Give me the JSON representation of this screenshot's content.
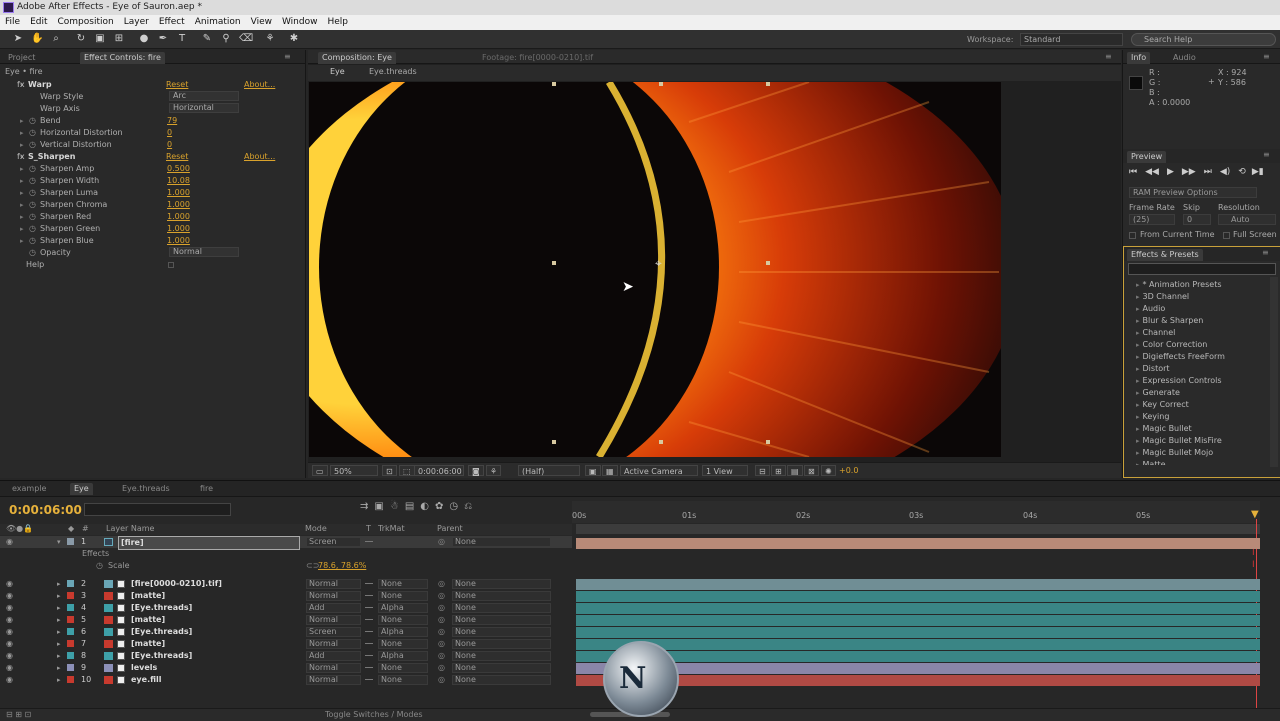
{
  "window": {
    "title": "Adobe After Effects - Eye of Sauron.aep *"
  },
  "menu": [
    "File",
    "Edit",
    "Composition",
    "Layer",
    "Effect",
    "Animation",
    "View",
    "Window",
    "Help"
  ],
  "toolbar": {
    "workspace_label": "Workspace:",
    "workspace_value": "Standard",
    "search_help": "Search Help"
  },
  "effect_panel": {
    "tabs": [
      "Project",
      "Effect Controls: fire"
    ],
    "breadcrumb": "Eye • fire",
    "warp": {
      "name": "Warp",
      "reset": "Reset",
      "about": "About...",
      "props": [
        {
          "label": "Warp Style",
          "value": "Arc",
          "type": "dropdown"
        },
        {
          "label": "Warp Axis",
          "value": "Horizontal",
          "type": "dropdown"
        },
        {
          "label": "Bend",
          "value": "79"
        },
        {
          "label": "Horizontal Distortion",
          "value": "0"
        },
        {
          "label": "Vertical Distortion",
          "value": "0"
        }
      ]
    },
    "sharpen": {
      "name": "S_Sharpen",
      "reset": "Reset",
      "about": "About...",
      "props": [
        {
          "label": "Sharpen Amp",
          "value": "0.500"
        },
        {
          "label": "Sharpen Width",
          "value": "10.08"
        },
        {
          "label": "Sharpen Luma",
          "value": "1.000"
        },
        {
          "label": "Sharpen Chroma",
          "value": "1.000"
        },
        {
          "label": "Sharpen Red",
          "value": "1.000"
        },
        {
          "label": "Sharpen Green",
          "value": "1.000"
        },
        {
          "label": "Sharpen Blue",
          "value": "1.000"
        },
        {
          "label": "Opacity",
          "value": "Normal",
          "type": "dropdown"
        },
        {
          "label": "Help",
          "value": ""
        }
      ]
    }
  },
  "comp_panel": {
    "tab": "Composition: Eye",
    "footage_tab": "Footage: fire[0000-0210].tif",
    "breadcrumbs": [
      "Eye",
      "Eye.threads"
    ],
    "bottom": {
      "zoom": "50%",
      "timecode": "0:00:06:00",
      "resolution": "(Half)",
      "camera": "Active Camera",
      "views": "1 View",
      "exposure": "+0.0"
    }
  },
  "info_panel": {
    "tabs": [
      "Info",
      "Audio"
    ],
    "r": "R :",
    "g": "G :",
    "b": "B :",
    "a": "A : 0.0000",
    "x": "X : 924",
    "y": "Y : 586"
  },
  "preview_panel": {
    "tab": "Preview",
    "ram_options": "RAM Preview Options",
    "frame_rate_label": "Frame Rate",
    "skip_label": "Skip",
    "resolution_label": "Resolution",
    "frame_rate": "(25)",
    "skip": "0",
    "resolution": "Auto",
    "from_current": "From Current Time",
    "full_screen": "Full Screen"
  },
  "effects_presets": {
    "tab": "Effects & Presets",
    "items": [
      "* Animation Presets",
      "3D Channel",
      "Audio",
      "Blur & Sharpen",
      "Channel",
      "Color Correction",
      "Digieffects FreeForm",
      "Distort",
      "Expression Controls",
      "Generate",
      "Key Correct",
      "Keying",
      "Magic Bullet",
      "Magic Bullet MisFire",
      "Magic Bullet Mojo",
      "Matte"
    ]
  },
  "timeline": {
    "tabs": [
      "example",
      "Eye",
      "Eye.threads",
      "fire"
    ],
    "timecode": "0:00:06:00",
    "headers": {
      "layer_name": "Layer Name",
      "mode": "Mode",
      "t": "T",
      "trkmat": "TrkMat",
      "parent": "Parent"
    },
    "effects_label": "Effects",
    "scale_label": "Scale",
    "scale_value": "78.6, 78.6%",
    "ruler": [
      "00s",
      "01s",
      "02s",
      "03s",
      "04s",
      "05s"
    ],
    "layers": [
      {
        "num": "1",
        "name": "[fire]",
        "mode": "Screen",
        "trkmat": "",
        "parent": "None",
        "label_color": "#8a9aa8",
        "bar_color": "#b88a78"
      },
      {
        "num": "2",
        "name": "[fire[0000-0210].tif]",
        "mode": "Normal",
        "trkmat": "None",
        "parent": "None",
        "label_color": "#6aa6b6",
        "bar_color": "#708e95"
      },
      {
        "num": "3",
        "name": "[matte]",
        "mode": "Normal",
        "trkmat": "None",
        "parent": "None",
        "label_color": "#c83a2e",
        "bar_color": "#3a8585"
      },
      {
        "num": "4",
        "name": "[Eye.threads]",
        "mode": "Add",
        "trkmat": "Alpha",
        "parent": "None",
        "label_color": "#3ea0a8",
        "bar_color": "#3a8585"
      },
      {
        "num": "5",
        "name": "[matte]",
        "mode": "Normal",
        "trkmat": "None",
        "parent": "None",
        "label_color": "#c83a2e",
        "bar_color": "#3a8585"
      },
      {
        "num": "6",
        "name": "[Eye.threads]",
        "mode": "Screen",
        "trkmat": "Alpha",
        "parent": "None",
        "label_color": "#3ea0a8",
        "bar_color": "#3a8585"
      },
      {
        "num": "7",
        "name": "[matte]",
        "mode": "Normal",
        "trkmat": "None",
        "parent": "None",
        "label_color": "#c83a2e",
        "bar_color": "#3a8585"
      },
      {
        "num": "8",
        "name": "[Eye.threads]",
        "mode": "Add",
        "trkmat": "Alpha",
        "parent": "None",
        "label_color": "#3ea0a8",
        "bar_color": "#3a8585"
      },
      {
        "num": "9",
        "name": "levels",
        "mode": "Normal",
        "trkmat": "None",
        "parent": "None",
        "label_color": "#8c90b8",
        "bar_color": "#8a86a8"
      },
      {
        "num": "10",
        "name": "eye.fill",
        "mode": "Normal",
        "trkmat": "None",
        "parent": "None",
        "label_color": "#c83a2e",
        "bar_color": "#b04a44"
      }
    ],
    "toggle_label": "Toggle Switches / Modes"
  }
}
